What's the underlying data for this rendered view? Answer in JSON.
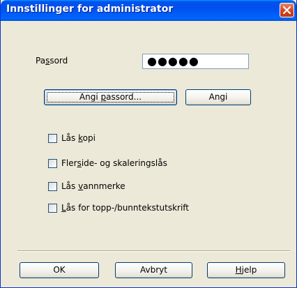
{
  "window": {
    "title": "Innstillinger for administrator"
  },
  "password": {
    "label_pre": "Pa",
    "label_accel": "s",
    "label_post": "sord",
    "value": "●●●●●"
  },
  "buttons": {
    "set_password": {
      "pre": "Angi ",
      "accel": "p",
      "post": "assord..."
    },
    "set": "Angi",
    "ok": "OK",
    "cancel": "Avbryt",
    "help": {
      "pre": "",
      "accel": "H",
      "post": "jelp"
    }
  },
  "checkboxes": [
    {
      "pre": "Lås ",
      "accel": "k",
      "post": "opi",
      "checked": false
    },
    {
      "pre": "Fler",
      "accel": "s",
      "post": "ide- og skaleringslås",
      "checked": false
    },
    {
      "pre": "Lås ",
      "accel": "v",
      "post": "annmerke",
      "checked": false
    },
    {
      "pre": "",
      "accel": "L",
      "post": "ås for topp-/bunntekstutskrift",
      "checked": false
    }
  ]
}
